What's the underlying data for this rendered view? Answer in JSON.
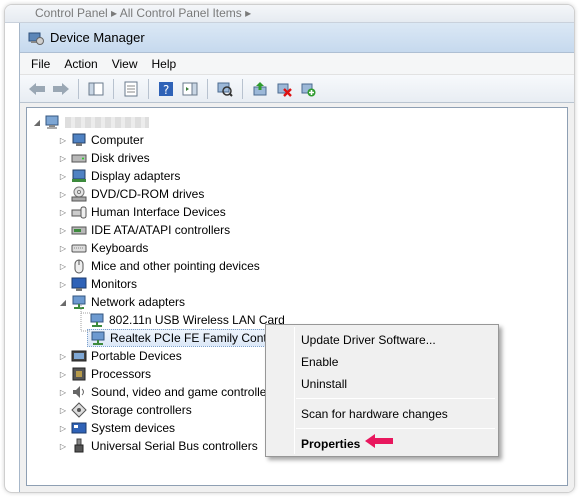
{
  "behind": {
    "breadcrumb": "Control Panel ▸ All Control Panel Items ▸"
  },
  "window": {
    "title": "Device Manager"
  },
  "menubar": {
    "items": [
      "File",
      "Action",
      "View",
      "Help"
    ]
  },
  "tree": {
    "root_label": "",
    "categories": [
      {
        "label": "Computer",
        "icon": "computer-icon"
      },
      {
        "label": "Disk drives",
        "icon": "disk-drive-icon"
      },
      {
        "label": "Display adapters",
        "icon": "display-adapter-icon"
      },
      {
        "label": "DVD/CD-ROM drives",
        "icon": "dvd-drive-icon"
      },
      {
        "label": "Human Interface Devices",
        "icon": "hid-icon"
      },
      {
        "label": "IDE ATA/ATAPI controllers",
        "icon": "ide-controller-icon"
      },
      {
        "label": "Keyboards",
        "icon": "keyboard-icon"
      },
      {
        "label": "Mice and other pointing devices",
        "icon": "mouse-icon"
      },
      {
        "label": "Monitors",
        "icon": "monitor-icon"
      },
      {
        "label": "Network adapters",
        "icon": "network-adapter-icon"
      },
      {
        "label": "802.11n USB Wireless LAN Card",
        "icon": "network-card-icon"
      },
      {
        "label": "Realtek PCIe FE Family Contro",
        "icon": "network-card-icon"
      },
      {
        "label": "Portable Devices",
        "icon": "portable-device-icon"
      },
      {
        "label": "Processors",
        "icon": "processor-icon"
      },
      {
        "label": "Sound, video and game controller",
        "icon": "sound-icon"
      },
      {
        "label": "Storage controllers",
        "icon": "storage-icon"
      },
      {
        "label": "System devices",
        "icon": "system-device-icon"
      },
      {
        "label": "Universal Serial Bus controllers",
        "icon": "usb-icon"
      }
    ]
  },
  "context_menu": {
    "update_driver": "Update Driver Software...",
    "enable": "Enable",
    "uninstall": "Uninstall",
    "scan": "Scan for hardware changes",
    "properties": "Properties"
  },
  "colors": {
    "accent": "#e8175d",
    "selection": "#dce8f7"
  }
}
